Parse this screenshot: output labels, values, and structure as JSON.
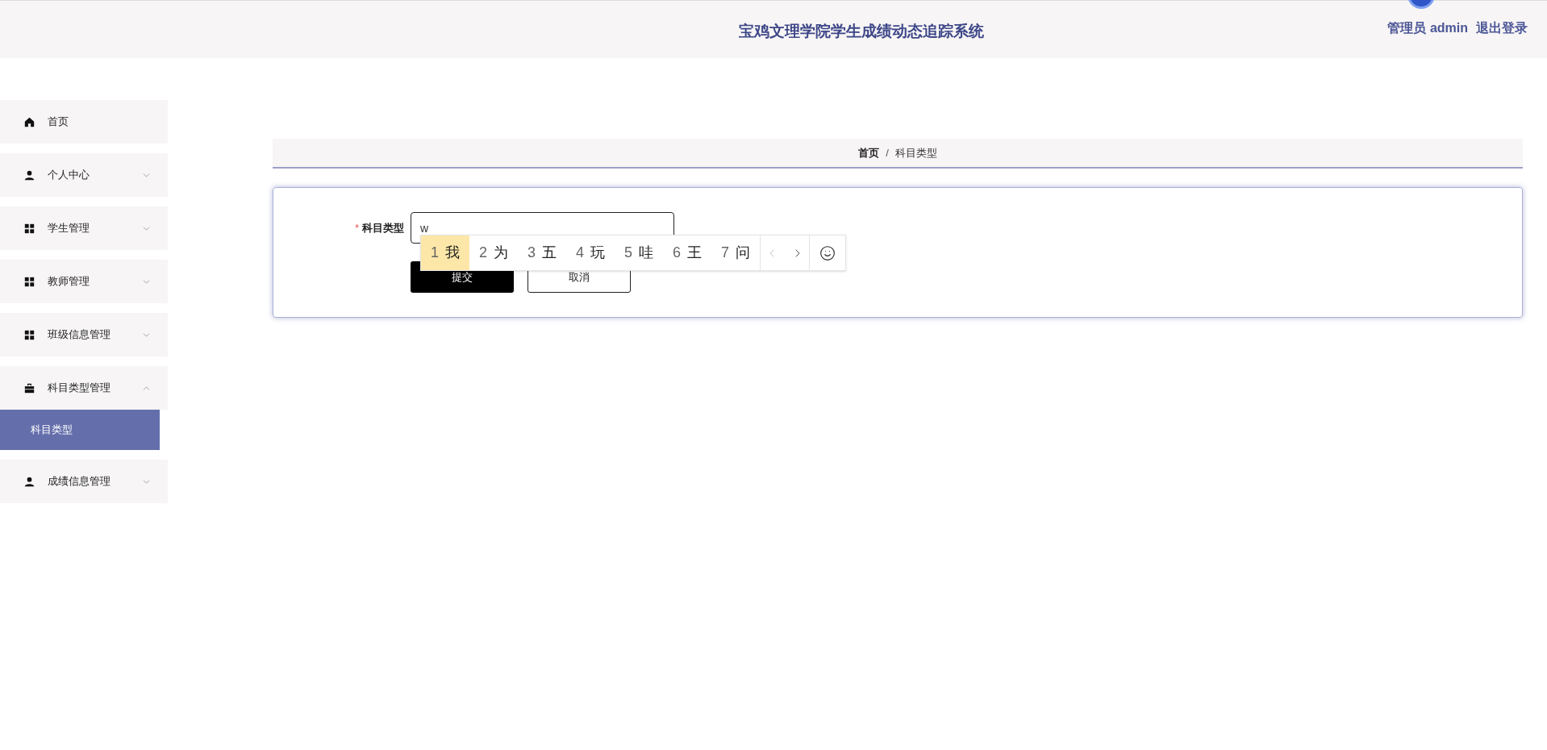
{
  "header": {
    "title": "宝鸡文理学院学生成绩动态追踪系统",
    "user": "管理员 admin",
    "logout": "退出登录"
  },
  "sidebar": {
    "items": [
      {
        "kind": "link",
        "label": "首页"
      },
      {
        "kind": "menu",
        "label": "个人中心",
        "expanded": false
      },
      {
        "kind": "menu",
        "label": "学生管理",
        "expanded": false
      },
      {
        "kind": "menu",
        "label": "教师管理",
        "expanded": false
      },
      {
        "kind": "menu",
        "label": "班级信息管理",
        "expanded": false
      },
      {
        "kind": "menu",
        "label": "科目类型管理",
        "expanded": true,
        "children": [
          {
            "label": "科目类型",
            "selected": true
          }
        ]
      },
      {
        "kind": "menu",
        "label": "成绩信息管理",
        "expanded": false
      }
    ]
  },
  "breadcrumb": [
    {
      "label": "首页",
      "kind": "home"
    },
    {
      "label": "/",
      "kind": "separator"
    },
    {
      "label": "科目类型",
      "kind": "current"
    }
  ],
  "form": {
    "field": {
      "label": "科目类型",
      "required_mark": "*",
      "value": "w"
    },
    "buttons": [
      {
        "label": "提交",
        "kind": "primary"
      },
      {
        "label": "取消",
        "kind": "secondary"
      }
    ]
  },
  "ime": {
    "candidates": [
      {
        "number": "1",
        "text": "我",
        "selected": true
      },
      {
        "number": "2",
        "text": "为",
        "selected": false
      },
      {
        "number": "3",
        "text": "五",
        "selected": false
      },
      {
        "number": "4",
        "text": "玩",
        "selected": false
      },
      {
        "number": "5",
        "text": "哇",
        "selected": false
      },
      {
        "number": "6",
        "text": "王",
        "selected": false
      },
      {
        "number": "7",
        "text": "问",
        "selected": false
      }
    ],
    "prev_disabled": true
  }
}
